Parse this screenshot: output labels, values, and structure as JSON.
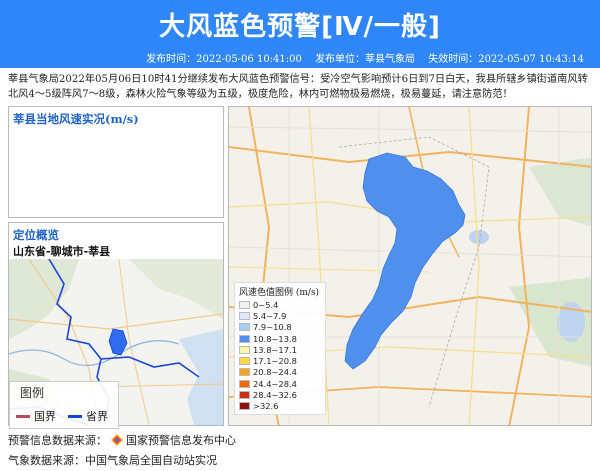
{
  "header": {
    "title": "大风蓝色预警[Ⅳ/一般]",
    "publish_time": "发布时间：2022-05-06 10:41:00",
    "publisher": "发布单位：莘县气象局",
    "expire_time": "失效时间：2022-05-07 10:43:14"
  },
  "description": "莘县气象局2022年05月06日10时41分继续发布大风蓝色预警信号：受冷空气影响预计6日到7日白天，我县所辖乡镇街道南风转北风4～5级阵风7～8级，森林火险气象等级为五级，极度危险，林内可燃物极易燃烧，极易蔓延，请注意防范！",
  "wind_panel": {
    "title": "莘县当地风速实况(m/s)"
  },
  "location_panel": {
    "title": "定位概览",
    "path": "山东省-聊城市-莘县",
    "legend": {
      "title": "图例",
      "national_border": "国界",
      "provincial_border": "省界"
    }
  },
  "wind_legend": {
    "title": "风速色值图例 (m/s)",
    "items": [
      {
        "label": "0~5.4",
        "color": "#f2f2f2"
      },
      {
        "label": "5.4~7.9",
        "color": "#dbe9f8"
      },
      {
        "label": "7.9~10.8",
        "color": "#a8cdf3"
      },
      {
        "label": "10.8~13.8",
        "color": "#4f8fee"
      },
      {
        "label": "13.8~17.1",
        "color": "#fbf3a6"
      },
      {
        "label": "17.1~20.8",
        "color": "#f9d94a"
      },
      {
        "label": "20.8~24.4",
        "color": "#f7a61b"
      },
      {
        "label": "24.4~28.4",
        "color": "#ee6a10"
      },
      {
        "label": "28.4~32.6",
        "color": "#cf2d12"
      },
      {
        "label": ">32.6",
        "color": "#8e1010"
      }
    ]
  },
  "footer": {
    "warning_source_label": "预警信息数据来源：",
    "warning_source_name": "国家预警信息发布中心",
    "weather_source": "气象数据来源：中国气象局全国自动站实况"
  },
  "colors": {
    "header_bg": "#2f86f6",
    "warning_area": "#4f8fee",
    "national_border": "#b24b63",
    "provincial_border": "#1846d8"
  }
}
